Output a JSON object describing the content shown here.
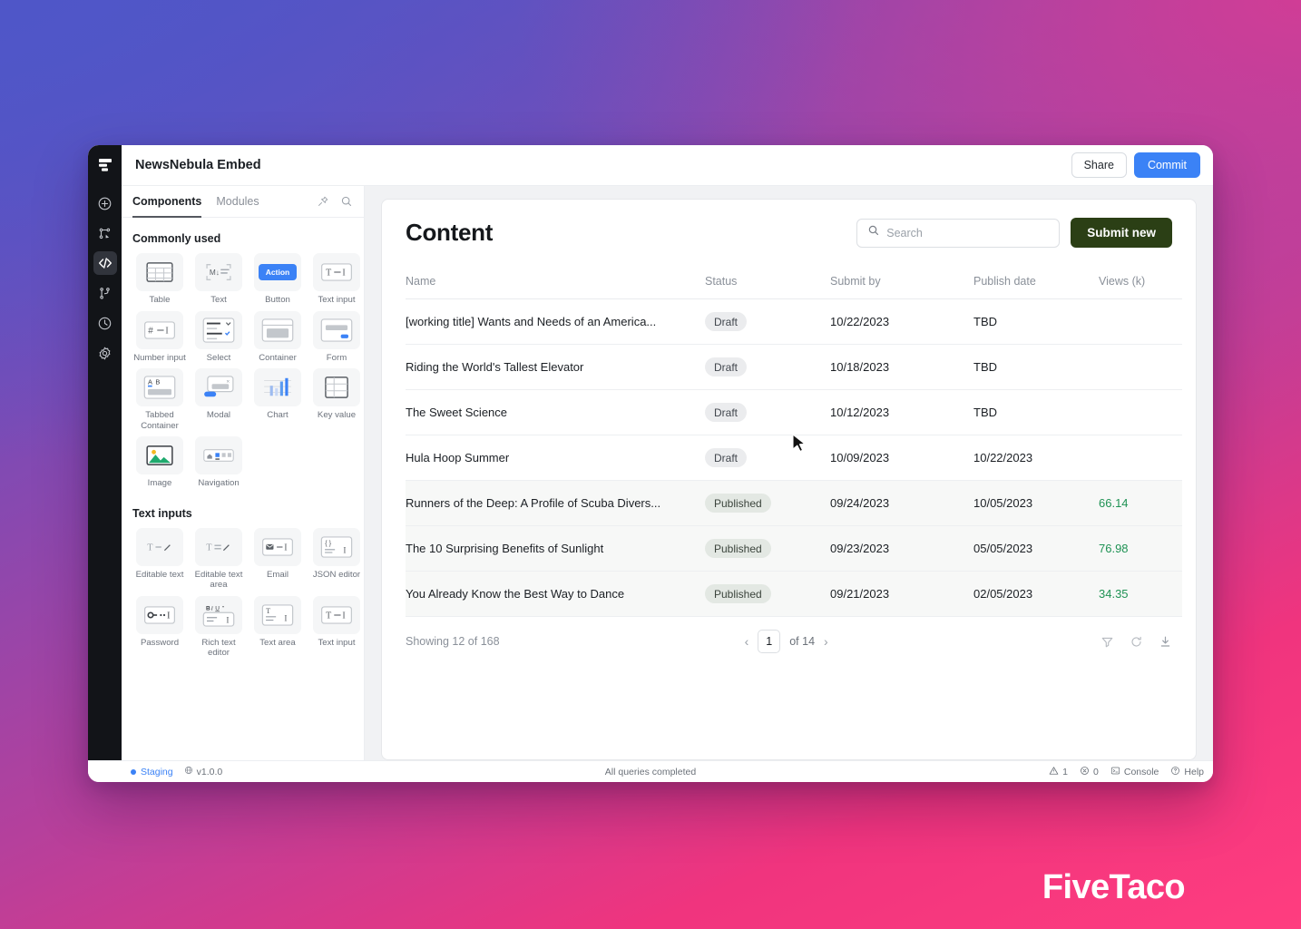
{
  "watermark": "FiveTaco",
  "titlebar": {
    "app_title": "NewsNebula Embed",
    "share_label": "Share",
    "commit_label": "Commit",
    "commit_color": "#3b82f6"
  },
  "rail": {
    "items": [
      {
        "name": "app-logo-icon",
        "label": "logo"
      },
      {
        "name": "add-icon",
        "label": "Add"
      },
      {
        "name": "components-tree-icon",
        "label": "Components tree"
      },
      {
        "name": "code-icon",
        "label": "Code",
        "active": true
      },
      {
        "name": "branches-icon",
        "label": "Branches"
      },
      {
        "name": "history-icon",
        "label": "History"
      },
      {
        "name": "settings-gear-icon",
        "label": "Settings"
      }
    ]
  },
  "panel": {
    "tabs": [
      {
        "label": "Components",
        "active": true
      },
      {
        "label": "Modules",
        "active": false
      }
    ],
    "pin_icon": "pin-icon",
    "search_icon": "search-icon",
    "sections": [
      {
        "title": "Commonly used",
        "items": [
          {
            "label": "Table",
            "icon": "table-icon"
          },
          {
            "label": "Text",
            "icon": "markdown-text-icon"
          },
          {
            "label": "Button",
            "icon": "button-icon",
            "badge": "Action"
          },
          {
            "label": "Text input",
            "icon": "text-input-icon"
          },
          {
            "label": "Number input",
            "icon": "number-input-icon"
          },
          {
            "label": "Select",
            "icon": "select-icon"
          },
          {
            "label": "Container",
            "icon": "container-icon"
          },
          {
            "label": "Form",
            "icon": "form-icon"
          },
          {
            "label": "Tabbed Container",
            "icon": "tabbed-container-icon"
          },
          {
            "label": "Modal",
            "icon": "modal-icon"
          },
          {
            "label": "Chart",
            "icon": "chart-icon"
          },
          {
            "label": "Key value",
            "icon": "key-value-icon"
          },
          {
            "label": "Image",
            "icon": "image-icon"
          },
          {
            "label": "Navigation",
            "icon": "navigation-icon"
          }
        ]
      },
      {
        "title": "Text inputs",
        "items": [
          {
            "label": "Editable text",
            "icon": "editable-text-icon"
          },
          {
            "label": "Editable text area",
            "icon": "editable-text-area-icon"
          },
          {
            "label": "Email",
            "icon": "email-icon"
          },
          {
            "label": "JSON editor",
            "icon": "json-editor-icon"
          },
          {
            "label": "Password",
            "icon": "password-icon"
          },
          {
            "label": "Rich text editor",
            "icon": "rich-text-editor-icon"
          },
          {
            "label": "Text area",
            "icon": "text-area-icon"
          },
          {
            "label": "Text input",
            "icon": "text-input-icon"
          }
        ]
      }
    ]
  },
  "content": {
    "page_title": "Content",
    "search_placeholder": "Search",
    "search_value": "",
    "submit_label": "Submit new",
    "submit_color": "#2b3f15",
    "columns": [
      "Name",
      "Status",
      "Submit by",
      "Publish date",
      "Views (k)"
    ],
    "rows": [
      {
        "name": "[working title] Wants and Needs of an America...",
        "status": "Draft",
        "submit_by": "10/22/2023",
        "publish_date": "TBD",
        "views": ""
      },
      {
        "name": "Riding the World's Tallest Elevator",
        "status": "Draft",
        "submit_by": "10/18/2023",
        "publish_date": "TBD",
        "views": ""
      },
      {
        "name": "The Sweet Science",
        "status": "Draft",
        "submit_by": "10/12/2023",
        "publish_date": "TBD",
        "views": ""
      },
      {
        "name": "Hula Hoop Summer",
        "status": "Draft",
        "submit_by": "10/09/2023",
        "publish_date": "10/22/2023",
        "views": ""
      },
      {
        "name": "Runners of the Deep: A Profile of Scuba Divers...",
        "status": "Published",
        "submit_by": "09/24/2023",
        "publish_date": "10/05/2023",
        "views": "66.14"
      },
      {
        "name": "The 10 Surprising Benefits of Sunlight",
        "status": "Published",
        "submit_by": "09/23/2023",
        "publish_date": "05/05/2023",
        "views": "76.98"
      },
      {
        "name": "You Already Know the Best Way to Dance",
        "status": "Published",
        "submit_by": "09/21/2023",
        "publish_date": "02/05/2023",
        "views": "34.35"
      }
    ],
    "footer": {
      "showing": "Showing 12 of 168",
      "prev_icon": "chevron-left-icon",
      "page": "1",
      "of_label": "of 14",
      "next_icon": "chevron-right-icon",
      "filter_icon": "filter-icon",
      "refresh_icon": "refresh-icon",
      "download_icon": "download-icon"
    },
    "views_color": "#1f9254"
  },
  "statusbar": {
    "env": "Staging",
    "version": "v1.0.0",
    "queries": "All queries completed",
    "warnings": "1",
    "errors": "0",
    "console_label": "Console",
    "help_label": "Help"
  }
}
